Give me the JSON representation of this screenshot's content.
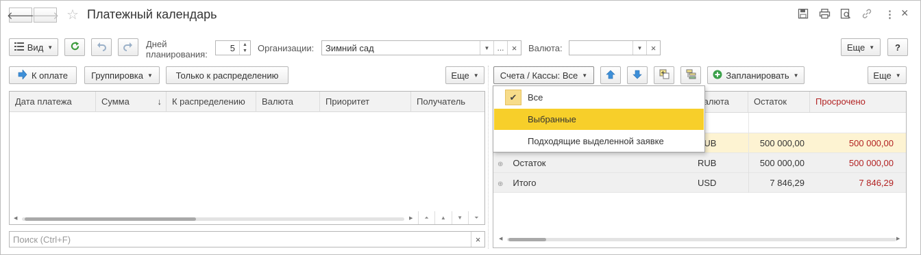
{
  "window": {
    "title": "Платежный календарь"
  },
  "toolbar": {
    "view_label": "Вид",
    "days_label": "Дней\nпланирования:",
    "days_line1": "Дней",
    "days_line2": "планирования:",
    "days_value": "5",
    "org_label": "Организации:",
    "org_value": "Зимний сад",
    "org_more": "...",
    "org_clear": "×",
    "currency_label": "Валюта:",
    "currency_value": "",
    "currency_clear": "×",
    "more_label": "Еще",
    "help_label": "?"
  },
  "left": {
    "to_pay_label": "К оплате",
    "grouping_label": "Группировка",
    "only_distribution_label": "Только к распределению",
    "more_label": "Еще",
    "columns": [
      "Дата платежа",
      "Сумма",
      "К распределению",
      "Валюта",
      "Приоритет",
      "Получатель"
    ],
    "sort_indicator": "↓",
    "search_placeholder": "Поиск (Ctrl+F)",
    "search_clear": "×"
  },
  "right": {
    "accounts_label": "Счета / Кассы: Все",
    "plan_label": "Запланировать",
    "more_label": "Еще",
    "columns": [
      "Валюта",
      "Остаток",
      "Просрочено"
    ],
    "rows": [
      {
        "name": "",
        "currency": "RUB",
        "balance": "500 000,00",
        "overdue": "500 000,00"
      },
      {
        "name": "Остаток",
        "currency": "RUB",
        "balance": "500 000,00",
        "overdue": "500 000,00"
      },
      {
        "name": "Итого",
        "currency": "USD",
        "balance": "7 846,29",
        "overdue": "7 846,29"
      }
    ]
  },
  "dropdown": {
    "items": [
      {
        "label": "Все",
        "checked": true
      },
      {
        "label": "Выбранные",
        "checked": false
      },
      {
        "label": "Подходящие выделенной заявке",
        "checked": false
      }
    ]
  },
  "colors": {
    "accent_yellow": "#f7cf2a",
    "overdue_red": "#b22222",
    "refresh_green": "#3a9a3a",
    "arrow_blue": "#3d8fd8"
  }
}
